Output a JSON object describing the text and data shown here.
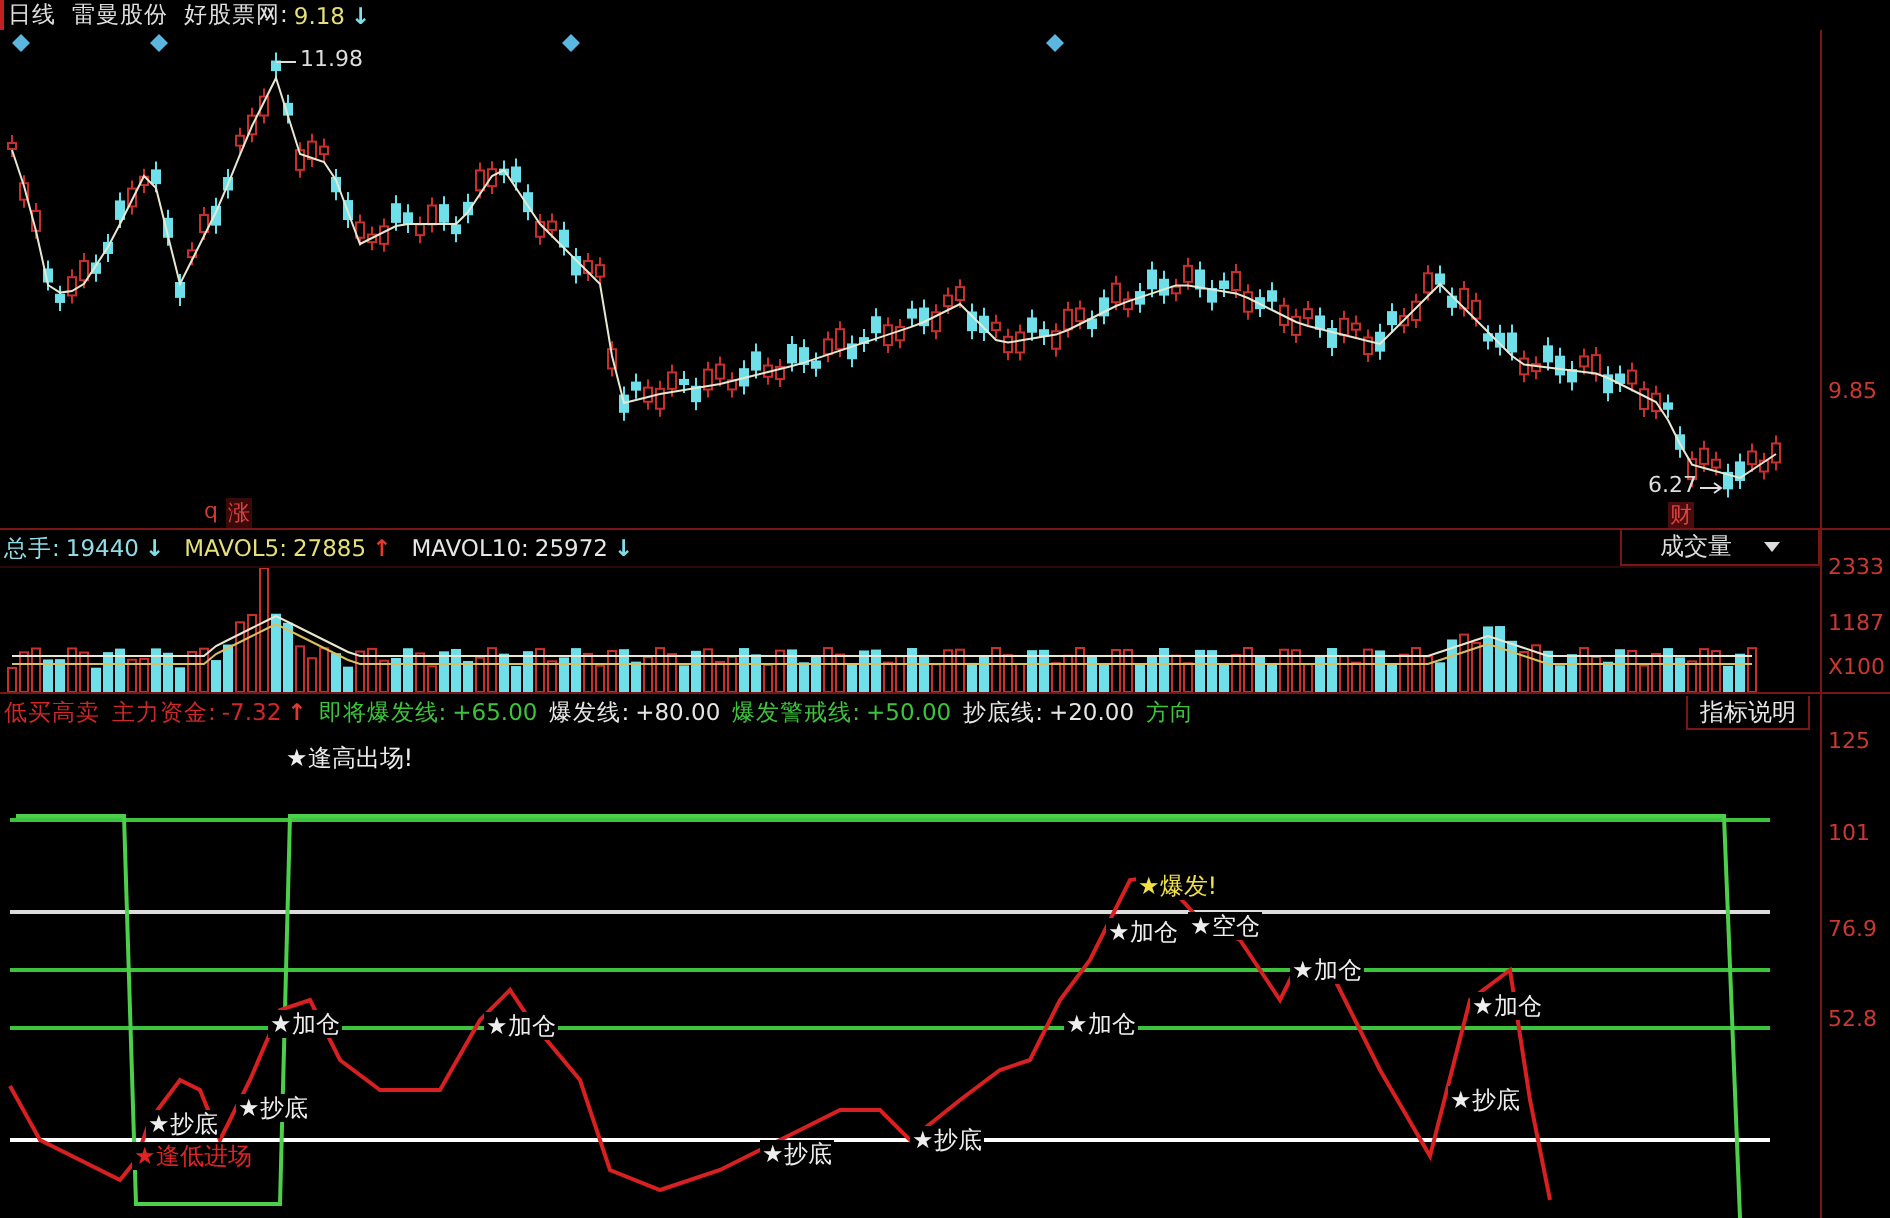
{
  "header": {
    "period": "日线",
    "stock_name": "雷曼股份",
    "source_label": "好股票网:",
    "price": "9.18",
    "arrow": "↓",
    "rising": false
  },
  "price_panel": {
    "high_label": "11.98",
    "low_label": "6.27",
    "marker": "q",
    "rise_tag": "涨",
    "finance_badge": "财",
    "axis_labels": [
      "9.85"
    ]
  },
  "volume_panel": {
    "legend": [
      {
        "label": "总手:",
        "value": "19440",
        "arrow": "↓",
        "rising": false,
        "color": "#8fdde6"
      },
      {
        "label": "MAVOL5:",
        "value": "27885",
        "arrow": "↑",
        "rising": true,
        "color": "#e6df7a"
      },
      {
        "label": "MAVOL10:",
        "value": "25972",
        "arrow": "↓",
        "rising": false,
        "color": "#e6e6e6"
      }
    ],
    "selector": {
      "value": "成交量"
    },
    "axis_labels": [
      "2333",
      "1187",
      "X100"
    ]
  },
  "indicator_panel": {
    "legend": [
      {
        "label": "低买高卖",
        "color": "#d02828"
      },
      {
        "label": "主力资金:",
        "value": "-7.32",
        "arrow": "↑",
        "rising": true,
        "color": "#d02828"
      },
      {
        "label": "即将爆发线:",
        "value": "+65.00",
        "color": "#3cc43c"
      },
      {
        "label": "爆发线:",
        "value": "+80.00",
        "color": "#e6e6e6"
      },
      {
        "label": "爆发警戒线:",
        "value": "+50.00",
        "color": "#3cc43c"
      },
      {
        "label": "抄底线:",
        "value": "+20.00",
        "color": "#e6e6e6"
      },
      {
        "label": "方向",
        "color": "#3cc43c"
      }
    ],
    "help_button": "指标说明",
    "axis_labels": [
      "125",
      "101",
      "76.9",
      "52.8"
    ],
    "signals": [
      {
        "text": "★逢高出场!",
        "kind": "signal"
      },
      {
        "text": "★抄底",
        "kind": "signal"
      },
      {
        "text": "★逢低进场",
        "kind": "entry"
      },
      {
        "text": "★抄底",
        "kind": "signal"
      },
      {
        "text": "★加仓",
        "kind": "signal"
      },
      {
        "text": "★加仓",
        "kind": "signal"
      },
      {
        "text": "★抄底",
        "kind": "signal"
      },
      {
        "text": "★抄底",
        "kind": "signal"
      },
      {
        "text": "★加仓",
        "kind": "signal"
      },
      {
        "text": "★爆发!",
        "kind": "burst"
      },
      {
        "text": "★加仓",
        "kind": "signal"
      },
      {
        "text": "★空仓",
        "kind": "signal"
      },
      {
        "text": "★加仓",
        "kind": "signal"
      },
      {
        "text": "★加仓",
        "kind": "signal"
      },
      {
        "text": "★抄底",
        "kind": "signal"
      }
    ]
  }
}
